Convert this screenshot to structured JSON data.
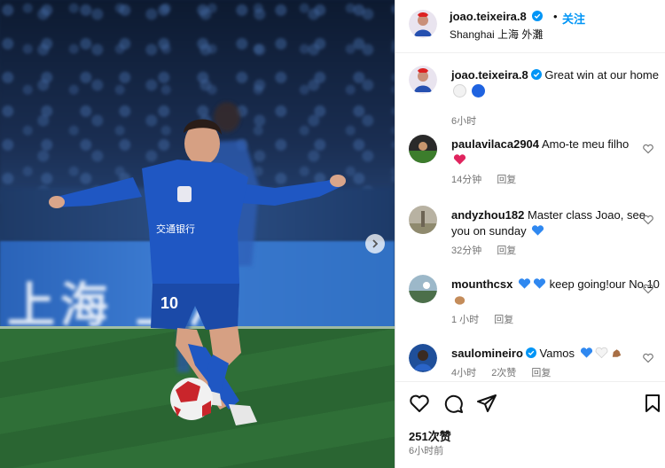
{
  "post": {
    "username": "joao.teixeira.8",
    "follow_label": "关注",
    "location": "Shanghai 上海 外灘",
    "separator": "•"
  },
  "caption": {
    "username": "joao.teixeira.8",
    "text": "Great win at our home",
    "time": "6小时"
  },
  "comments": [
    {
      "username": "paulavilaca2904",
      "text": "Amo-te meu filho",
      "time": "14分钟",
      "reply": "回复",
      "likes": ""
    },
    {
      "username": "andyzhou182",
      "text": "Master class Joao, see you on sunday",
      "time": "32分钟",
      "reply": "回复",
      "likes": ""
    },
    {
      "username": "mounthcsx",
      "text": "keep going!our No.10",
      "time": "1 小时",
      "reply": "回复",
      "likes": ""
    },
    {
      "username": "saulomineiro",
      "text": "Vamos",
      "time": "4小时",
      "reply": "回复",
      "likes": "2次赞"
    }
  ],
  "footer": {
    "likes": "251次赞",
    "time_ago": "6小时前"
  },
  "photo": {
    "jersey_number": "10",
    "sponsor_text": "交通银行"
  },
  "icons": {
    "verified": "verified-badge-icon",
    "next": "chevron-right-icon",
    "like": "heart-icon",
    "comment": "comment-bubble-icon",
    "share": "paper-plane-icon",
    "save": "bookmark-icon"
  },
  "colors": {
    "accent": "#0095f6",
    "muted": "#737373",
    "jersey": "#1f57c3"
  }
}
